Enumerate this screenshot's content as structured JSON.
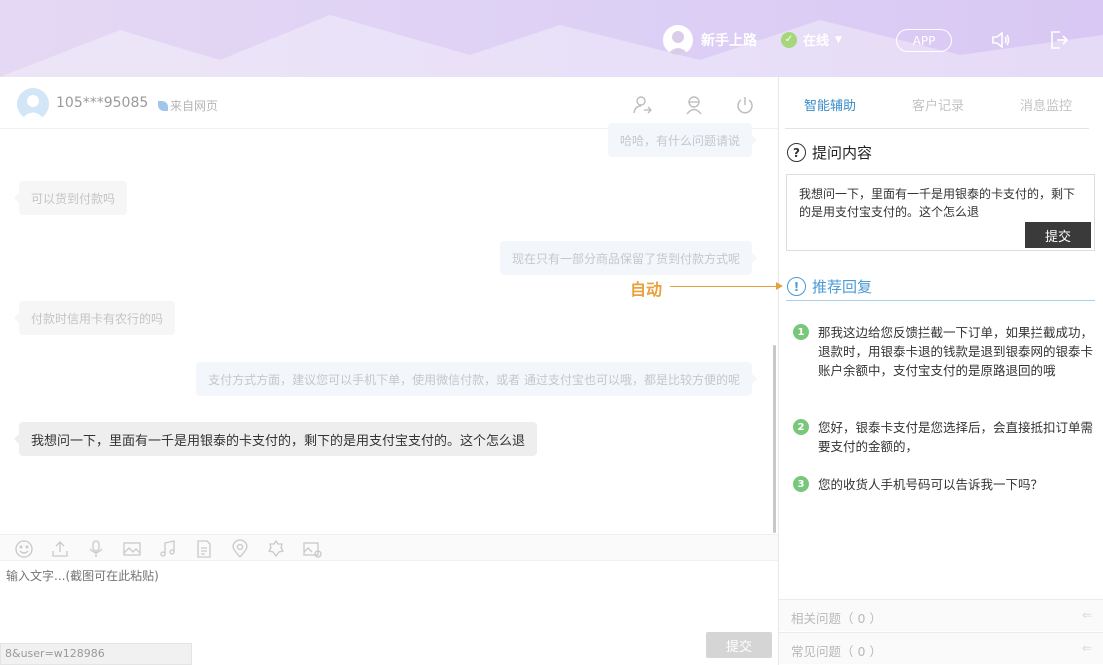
{
  "topbar": {
    "username": "新手上路",
    "status_label": "在线",
    "app_label": "APP",
    "colors": {
      "accent": "#3a8cc7",
      "online": "#a7d77c",
      "banner": "#ddd0f5"
    }
  },
  "chat_header": {
    "visitor_id": "105***95085",
    "source": "来自网页"
  },
  "messages": [
    {
      "side": "right",
      "text": "哈哈，有什么问题请说"
    },
    {
      "side": "left",
      "text": "可以货到付款吗"
    },
    {
      "side": "right",
      "text": "现在只有一部分商品保留了货到付款方式呢"
    },
    {
      "side": "left",
      "text": "付款时信用卡有农行的吗"
    },
    {
      "side": "right",
      "text": "支付方式方面，建议您可以手机下单，使用微信付款，或者 通过支付宝也可以哦，都是比较方便的呢"
    },
    {
      "side": "left",
      "text": "我想问一下，里面有一千是用银泰的卡支付的，剩下的是用支付宝支付的。这个怎么退"
    }
  ],
  "input": {
    "placeholder": "输入文字...(截图可在此粘贴)",
    "send_label": "提交",
    "url_status": "8&user=w128986"
  },
  "right_panel": {
    "tabs": [
      {
        "label": "智能辅助",
        "active": true
      },
      {
        "label": "客户记录",
        "active": false
      },
      {
        "label": "消息监控",
        "active": false
      }
    ],
    "question_title": "提问内容",
    "question_text": "我想问一下，里面有一千是用银泰的卡支付的，剩下的是用支付宝支付的。这个怎么退",
    "submit_label": "提交",
    "recommend_title": "推荐回复",
    "recommendations": [
      {
        "num": "1",
        "text": "那我这边给您反馈拦截一下订单，如果拦截成功，退款时，用银泰卡退的钱款是退到银泰网的银泰卡账户余额中，支付宝支付的是原路退回的哦"
      },
      {
        "num": "2",
        "text": "您好，银泰卡支付是您选择后，会直接抵扣订单需要支付的金额的，"
      },
      {
        "num": "3",
        "text": "您的收货人手机号码可以告诉我一下吗？"
      }
    ],
    "related_label": "相关问题（ 0 ）",
    "common_label": "常见问题（ 0 ）"
  },
  "annotation": {
    "label": "自动"
  }
}
